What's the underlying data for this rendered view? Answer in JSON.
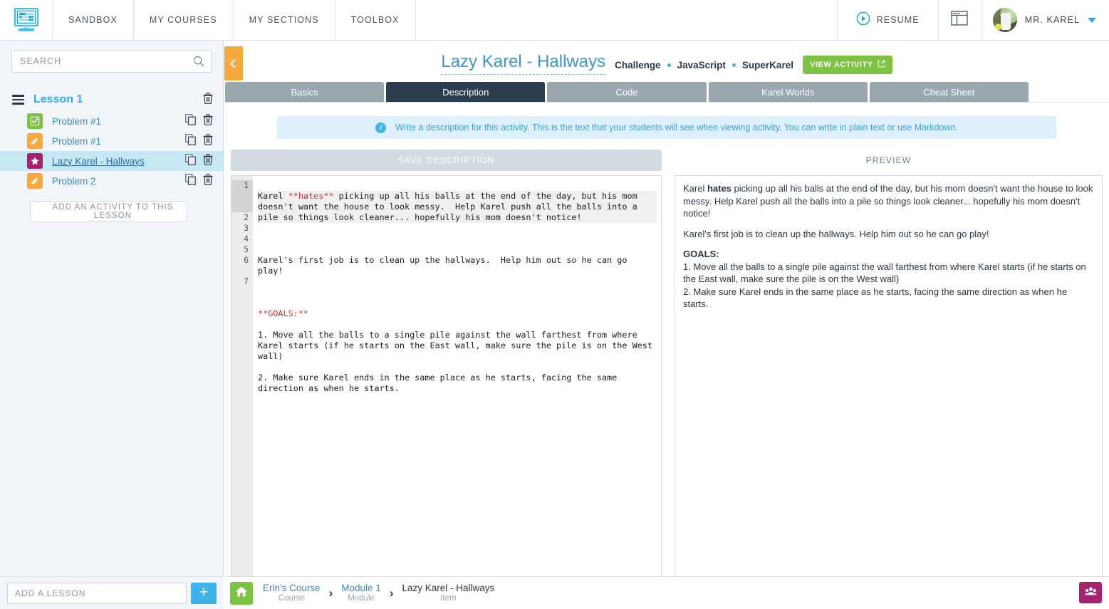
{
  "topnav": {
    "logo_icon": "monitor-logo-icon",
    "items": [
      {
        "label": "SANDBOX"
      },
      {
        "label": "MY COURSES"
      },
      {
        "label": "MY SECTIONS"
      },
      {
        "label": "TOOLBOX"
      }
    ],
    "resume_label": "RESUME",
    "resume_icon": "play-circle-icon",
    "window_icon": "window-layout-icon",
    "user_name": "MR. KAREL",
    "user_caret_icon": "chevron-down-icon"
  },
  "sidebar": {
    "search_placeholder": "SEARCH",
    "search_value": "",
    "search_icon": "search-icon",
    "lesson": {
      "title": "Lesson 1",
      "drag_icon": "drag-handle-icon",
      "delete_icon": "trash-icon"
    },
    "activities": [
      {
        "label": "Problem #1",
        "badge": "check",
        "badge_color": "#7dc242",
        "selected": false
      },
      {
        "label": "Problem #1",
        "badge": "pencil",
        "badge_color": "#f5a93f",
        "selected": false
      },
      {
        "label": "Lazy Karel - Hallways",
        "badge": "star",
        "badge_color": "#a3246c",
        "selected": true
      },
      {
        "label": "Problem 2",
        "badge": "pencil",
        "badge_color": "#f5a93f",
        "selected": false
      }
    ],
    "add_activity_label": "ADD AN ACTIVITY TO THIS LESSON",
    "copy_icon": "copy-icon",
    "trash_icon": "trash-icon",
    "footer": {
      "add_lesson_placeholder": "ADD A LESSON",
      "add_lesson_value": "",
      "add_button_label": "+"
    }
  },
  "main": {
    "collapse_icon": "chevron-left-icon",
    "activity_title": "Lazy Karel - Hallways",
    "meta": [
      "Challenge",
      "JavaScript",
      "SuperKarel"
    ],
    "view_activity_label": "VIEW ACTIVITY",
    "view_activity_icon": "external-link-icon",
    "tabs": [
      {
        "label": "Basics",
        "active": false
      },
      {
        "label": "Description",
        "active": true
      },
      {
        "label": "Code",
        "active": false
      },
      {
        "label": "Karel Worlds",
        "active": false
      },
      {
        "label": "Cheat Sheet",
        "active": false
      }
    ],
    "info_banner": {
      "icon": "info-circle-icon",
      "text": "Write a description for this activity. This is the text that your students will see when viewing activity. You can write in plain text or use Markdown."
    },
    "save_button_label": "SAVE DESCRIPTION",
    "preview_label": "PREVIEW",
    "editor": {
      "line_numbers": [
        "1",
        "2",
        "3",
        "4",
        "5",
        "6",
        "7"
      ],
      "lines": [
        "Karel **hates** picking up all his balls at the end of the day, but his mom doesn't want the house to look messy.  Help Karel push all the balls into a pile so things look cleaner... hopefully his mom doesn't notice!",
        "",
        "Karel's first job is to clean up the hallways.  Help him out so he can go play!",
        "",
        "**GOALS:**",
        "1. Move all the balls to a single pile against the wall farthest from where Karel starts (if he starts on the East wall, make sure the pile is on the West wall)",
        "2. Make sure Karel ends in the same place as he starts, facing the same direction as when he starts."
      ]
    },
    "preview_content": {
      "p1_a": "Karel ",
      "p1_bold": "hates",
      "p1_b": " picking up all his balls at the end of the day, but his mom doesn't want the house to look messy. Help Karel push all the balls into a pile so things look cleaner... hopefully his mom doesn't notice!",
      "p2": "Karel's first job is to clean up the hallways. Help him out so he can go play!",
      "goals_heading": "GOALS:",
      "goal1": "1. Move all the balls to a single pile against the wall farthest from where Karel starts (if he starts on the East wall, make sure the pile is on the West wall)",
      "goal2": "2. Make sure Karel ends in the same place as he starts, facing the same direction as when he starts."
    }
  },
  "bottom_bar": {
    "home_icon": "home-icon",
    "breadcrumbs": [
      {
        "name": "Erin's Course",
        "type": "Course"
      },
      {
        "name": "Module 1",
        "type": "Module"
      },
      {
        "name": "Lazy Karel - Hallways",
        "type": "Item"
      }
    ],
    "separator": "›",
    "help_icon": "help-people-icon"
  },
  "colors": {
    "brand_blue": "#3eb3e8",
    "accent_green": "#7dc242",
    "accent_orange": "#f5a93f",
    "accent_pink": "#a3246c",
    "tab_active": "#2c3d50",
    "tab_inactive": "#9aa8ae",
    "selected_row": "#c6e8f5"
  }
}
